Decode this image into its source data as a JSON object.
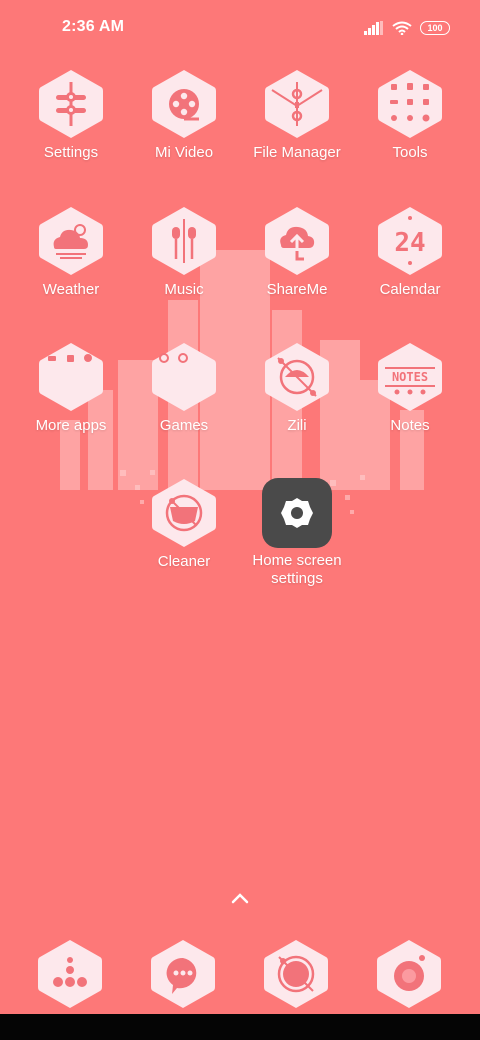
{
  "status": {
    "time": "2:36 AM",
    "battery": "100"
  },
  "apps": [
    {
      "label": "Settings"
    },
    {
      "label": "Mi Video"
    },
    {
      "label": "File Manager"
    },
    {
      "label": "Tools"
    },
    {
      "label": "Weather"
    },
    {
      "label": "Music"
    },
    {
      "label": "ShareMe"
    },
    {
      "label": "Calendar",
      "date": "24"
    },
    {
      "label": "More apps"
    },
    {
      "label": "Games"
    },
    {
      "label": "Zili"
    },
    {
      "label": "Notes",
      "icon_text": "NOTES"
    },
    {
      "label": "Cleaner"
    },
    {
      "label": "Home screen settings",
      "label_line1": "Home screen",
      "label_line2": "settings"
    }
  ],
  "dock": [
    "phone-icon",
    "messaging-icon",
    "browser-icon",
    "camera-icon"
  ],
  "colors": {
    "background": "#fd7878",
    "tile": "#fde8ec",
    "accent": "#f2737a",
    "gear_tile": "#4a4a4a"
  }
}
